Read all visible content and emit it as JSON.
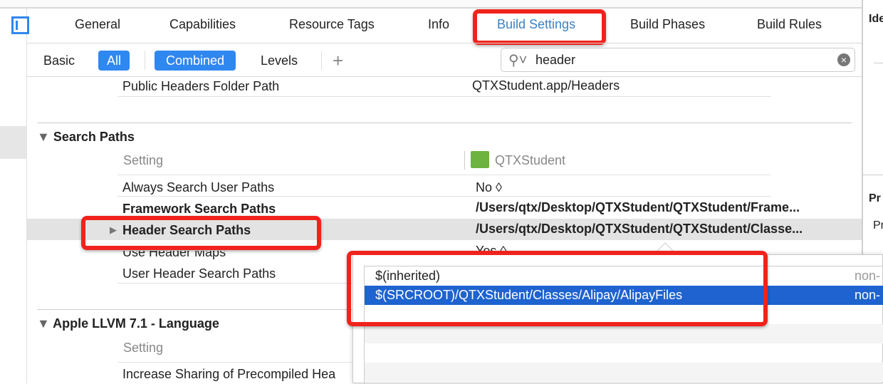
{
  "tabs": [
    "General",
    "Capabilities",
    "Resource Tags",
    "Info",
    "Build Settings",
    "Build Phases",
    "Build Rules"
  ],
  "active_tab": "Build Settings",
  "filters": {
    "basic": "Basic",
    "all": "All",
    "combined": "Combined",
    "levels": "Levels",
    "add": "+"
  },
  "search": {
    "value": "header"
  },
  "inspector": {
    "label1": "Ide",
    "label2": "Pr",
    "label3": "Pr"
  },
  "settings": {
    "public_headers": {
      "name": "Public Headers Folder Path",
      "value": "QTXStudent.app/Headers"
    },
    "section_search": "Search Paths",
    "column_setting": "Setting",
    "column_target": "QTXStudent",
    "rows": [
      {
        "name": "Always Search User Paths",
        "value": "No ◊"
      },
      {
        "name": "Framework Search Paths",
        "value": "/Users/qtx/Desktop/QTXStudent/QTXStudent/Frame..."
      },
      {
        "name": "Header Search Paths",
        "value": "/Users/qtx/Desktop/QTXStudent/QTXStudent/Classe..."
      },
      {
        "name": "Use Header Maps",
        "value": "Yes ◊"
      },
      {
        "name": "User Header Search Paths",
        "value": ""
      }
    ],
    "section_llvm": "Apple LLVM 7.1 - Language",
    "llvm_setting": "Setting",
    "llvm_row": "Increase Sharing of Precompiled Hea"
  },
  "popup": {
    "items": [
      {
        "path": "$(inherited)",
        "kind": "non-"
      },
      {
        "path": "$(SRCROOT)/QTXStudent/Classes/Alipay/AlipayFiles",
        "kind": "non-"
      }
    ]
  },
  "colors": {
    "accent": "#2f87f0",
    "highlight": "#f0231c",
    "selection": "#1e63cf",
    "app_icon": "#6db33f"
  }
}
